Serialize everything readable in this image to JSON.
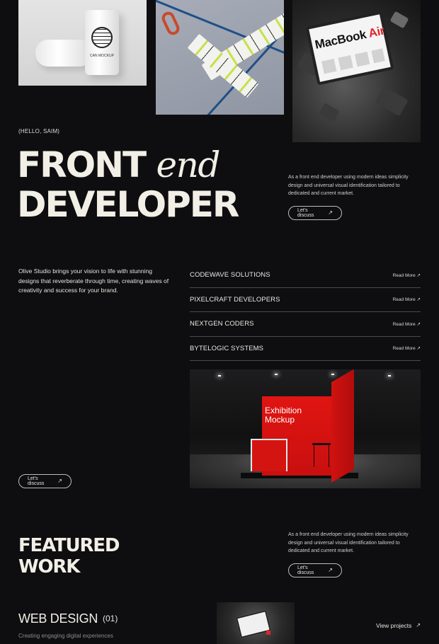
{
  "images": {
    "cans": {
      "label": "CAN MOCKUP"
    },
    "laptop": {
      "brand": "MacBook",
      "model": "Air"
    },
    "exhibition": {
      "title_line1": "Exhibition",
      "title_line2": "Mockup"
    }
  },
  "hero": {
    "greeting": "(HELLO, SAIM)",
    "title_bold": "FRONT",
    "title_italic": "end",
    "title_line2": "DEVELOPER",
    "description": "As a front end developer using modern ideas simplicity design and universal visual identification tailored to dedicated and current market.",
    "cta_label": "Let's discuss",
    "cta_icon": "arrow-up-right-icon"
  },
  "studio": {
    "description": "Olive Studio brings your vision to life with stunning designs that reverberate through time, creating waves of creativity and success for your brand.",
    "cta_label": "Let's discuss",
    "clients": [
      {
        "name": "CODEWAVE SOLUTIONS",
        "link": "Read More ↗"
      },
      {
        "name": "PIXELCRAFT DEVELOPERS",
        "link": "Read More ↗"
      },
      {
        "name": "NEXTGEN CODERS",
        "link": "Read More ↗"
      },
      {
        "name": "BYTELOGIC SYSTEMS",
        "link": "Read More ↗"
      }
    ]
  },
  "featured": {
    "title_line1": "FEATURED",
    "title_line2": "WORK",
    "description": "As a front end developer using modern ideas simplicity design and universal visual identification tailored to dedicated and current market.",
    "cta_label": "Let's discuss"
  },
  "work": {
    "category": "WEB DESIGN",
    "number": "(01)",
    "subtitle": "Creating engaging digital experiences",
    "view_label": "View projects"
  },
  "colors": {
    "background": "#0e0e10",
    "text": "#f1efe6",
    "accent_red": "#e0242b"
  }
}
